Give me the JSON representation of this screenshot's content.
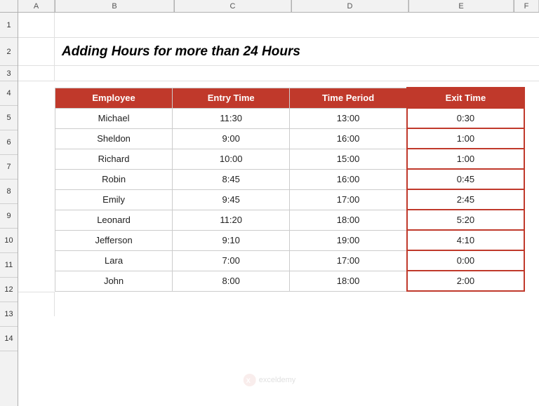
{
  "title": "Adding Hours for more than 24 Hours",
  "headers": {
    "col_a": "A",
    "col_b": "B",
    "col_c": "C",
    "col_d": "D",
    "col_e": "E",
    "col_f": "F"
  },
  "row_numbers": [
    "1",
    "2",
    "3",
    "4",
    "5",
    "6",
    "7",
    "8",
    "9",
    "10",
    "11",
    "12",
    "13",
    "14"
  ],
  "table": {
    "headers": [
      "Employee",
      "Entry Time",
      "Time Period",
      "Exit Time"
    ],
    "rows": [
      {
        "employee": "Michael",
        "entry": "11:30",
        "period": "13:00",
        "exit": "0:30"
      },
      {
        "employee": "Sheldon",
        "entry": "9:00",
        "period": "16:00",
        "exit": "1:00"
      },
      {
        "employee": "Richard",
        "entry": "10:00",
        "period": "15:00",
        "exit": "1:00"
      },
      {
        "employee": "Robin",
        "entry": "8:45",
        "period": "16:00",
        "exit": "0:45"
      },
      {
        "employee": "Emily",
        "entry": "9:45",
        "period": "17:00",
        "exit": "2:45"
      },
      {
        "employee": "Leonard",
        "entry": "11:20",
        "period": "18:00",
        "exit": "5:20"
      },
      {
        "employee": "Jefferson",
        "entry": "9:10",
        "period": "19:00",
        "exit": "4:10"
      },
      {
        "employee": "Lara",
        "entry": "7:00",
        "period": "17:00",
        "exit": "0:00"
      },
      {
        "employee": "John",
        "entry": "8:00",
        "period": "18:00",
        "exit": "2:00"
      }
    ]
  },
  "colors": {
    "header_bg": "#c0392b",
    "header_text": "#ffffff",
    "exit_border": "#c0392b",
    "grid_line": "#d0d0d0"
  },
  "watermark": {
    "text": "exceldemy"
  }
}
